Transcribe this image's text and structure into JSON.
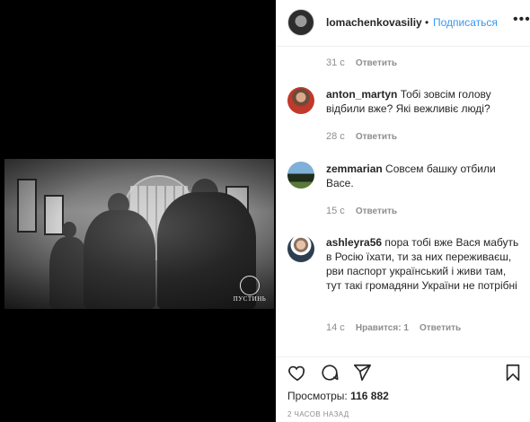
{
  "post": {
    "logo_text": "ПУСТИНЬ"
  },
  "header": {
    "username": "lomachenkovasiliy",
    "separator": "•",
    "follow_label": "Подписаться",
    "more_icon": "more-horizontal-icon",
    "more_glyph": "•••"
  },
  "comments": [
    {
      "time": "31 с",
      "reply_label": "Ответить"
    },
    {
      "username": "anton_martyn",
      "text": "Тобі зовсім голову відбили вже? Які вежливіє люді?",
      "time": "28 с",
      "reply_label": "Ответить"
    },
    {
      "username": "zemmarian",
      "text": "Совсем башку отбили Васе.",
      "time": "15 с",
      "reply_label": "Ответить"
    },
    {
      "username": "ashleyra56",
      "text": "пора тобі вже Вася мабуть в Росію їхати, ти за них переживаєш, рви паспорт український і живи там, тут такі громадяни України не потрібні",
      "time": "14 с",
      "likes": "Нравится: 1",
      "reply_label": "Ответить"
    }
  ],
  "actions": {
    "like_icon": "heart-icon",
    "comment_icon": "comment-icon",
    "share_icon": "share-icon",
    "save_icon": "bookmark-icon"
  },
  "stats": {
    "views_label": "Просмотры:",
    "views_count": "116 882",
    "posted": "2 ЧАСОВ НАЗАД"
  }
}
